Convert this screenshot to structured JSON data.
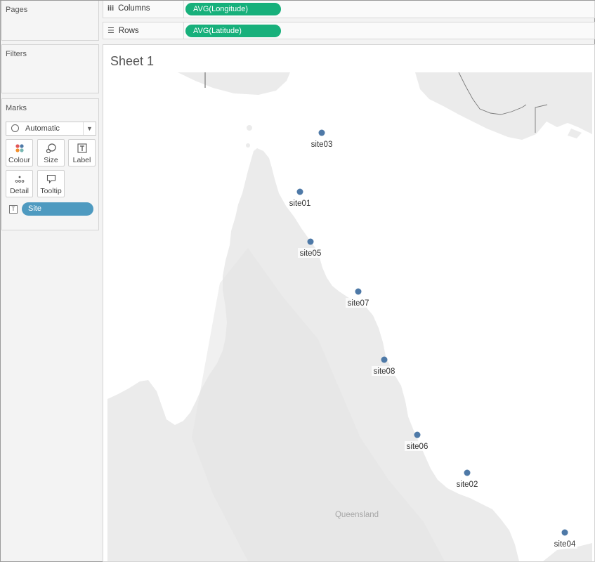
{
  "panels": {
    "pages_title": "Pages",
    "filters_title": "Filters",
    "marks_title": "Marks"
  },
  "marks": {
    "mark_type": "Automatic",
    "buttons": {
      "colour": "Colour",
      "size": "Size",
      "label": "Label",
      "detail": "Detail",
      "tooltip": "Tooltip"
    },
    "label_field": "Site",
    "label_field_icon": "T"
  },
  "shelves": {
    "columns_label": "Columns",
    "columns_pill": "AVG(Longitude)",
    "rows_label": "Rows",
    "rows_pill": "AVG(Latitude)"
  },
  "sheet": {
    "title": "Sheet 1",
    "region_label": "Queensland"
  },
  "map_data": {
    "mark_color": "#4e79a7",
    "land_color": "#ebebeb",
    "water_color": "#ffffff",
    "pill_color": "#17b07b",
    "label_pill_color": "#4e9ac0",
    "sites": [
      {
        "name": "site03"
      },
      {
        "name": "site01"
      },
      {
        "name": "site05"
      },
      {
        "name": "site07"
      },
      {
        "name": "site08"
      },
      {
        "name": "site06"
      },
      {
        "name": "site02"
      },
      {
        "name": "site04"
      }
    ]
  }
}
